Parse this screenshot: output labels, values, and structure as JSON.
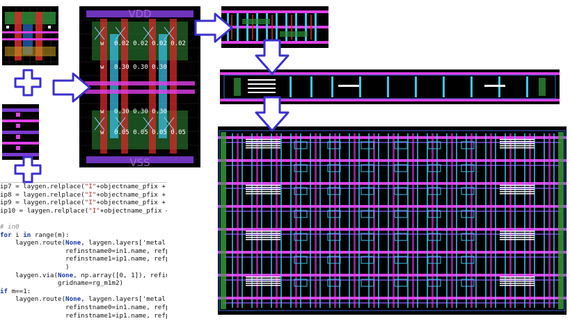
{
  "diagram_title": "",
  "layout_labels": {
    "vdd": "VDD",
    "vss": "VSS",
    "w": "w",
    "row_labels": [
      "0.02 0.02 0.02 0.02",
      "0.30 0.30 0.30",
      "0.30 0.30 0.30",
      "0.05 0.05 0.05 0.05"
    ],
    "row_prefixes": [
      "w",
      "w",
      "w",
      "w"
    ]
  },
  "code": {
    "lines": [
      "ip7 = laygen.relplace(\"I\"+objectname_pfix +",
      "ip8 = laygen.relplace(\"I\"+objectname_pfix +",
      "ip9 = laygen.relplace(\"I\"+objectname_pfix +",
      "ip10 = laygen.relplace(\"I\"+objectname_pfix +",
      "",
      "# in0",
      "for i in range(m):",
      "    laygen.route(None, laygen.layers['metal",
      "                 refinstname0=in1.name, refp",
      "                 refinstname1=ip1.name, refp",
      "                 )",
      "    laygen.via(None, np.array([0, 1]), refin",
      "               gridname=rg_m1m2)",
      "if m==1:",
      "    laygen.route(None, laygen.layers['metal",
      "                 refinstname0=in1.name, refp",
      "                 refinstname1=ip1.name, refp"
    ]
  },
  "colors": {
    "background": "#ffffff",
    "arrow_fill": "#ffffff",
    "arrow_stroke": "#3a2fd0",
    "layout_bg": "#000000",
    "metal_magenta": "#e040e8",
    "metal_cyan": "#3cc8f0",
    "poly_red": "#e03030",
    "diff_green": "#3aa040",
    "purple": "#7a4ad8",
    "yellow": "#e8c020"
  }
}
